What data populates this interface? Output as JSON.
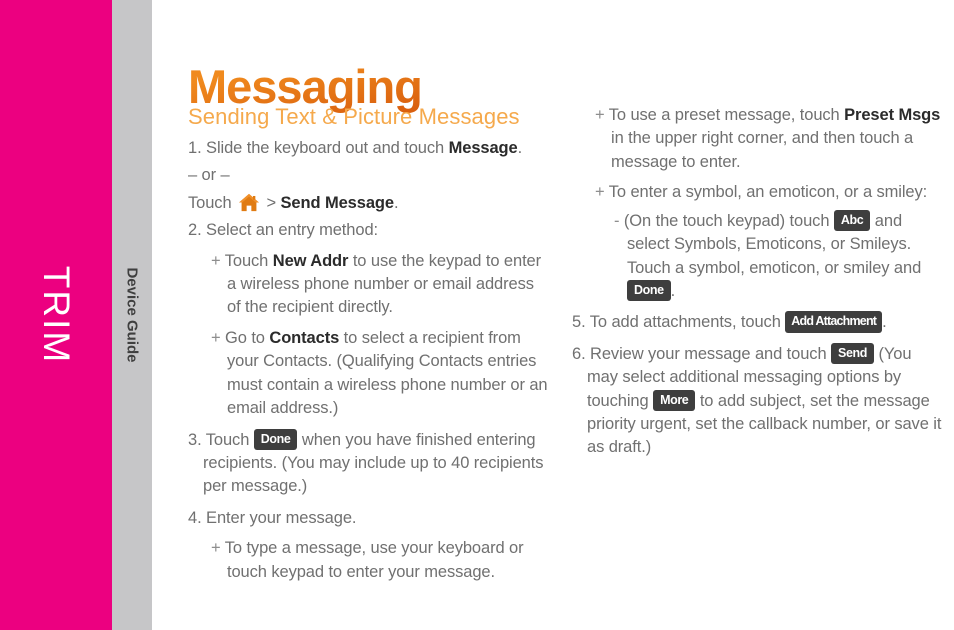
{
  "sidebar": {
    "brand": "TRIM",
    "guide_label": "Device Guide",
    "magenta_color": "#ec0080",
    "gray_color": "#c6c6c8"
  },
  "header": {
    "title": "Messaging",
    "title_color": "#e8801a"
  },
  "section": {
    "heading": "Sending Text & Picture Messages",
    "heading_color": "#f5a94c"
  },
  "keys": {
    "done": "Done",
    "abc": "Abc",
    "add_attachment": "Add Attachment",
    "send": "Send",
    "more": "More",
    "chip_bg": "#3e3e3e"
  },
  "icons": {
    "home": "home-icon"
  },
  "left_column": {
    "step1_pre": "1. Slide the keyboard out and touch ",
    "step1_bold": "Message",
    "step1_post": ".",
    "or_divider": "– or –",
    "touch_pre": "Touch ",
    "touch_sep": " > ",
    "touch_bold": "Send Message",
    "touch_post": ".",
    "step2": "2. Select an entry method:",
    "b1_mark": "+",
    "b1_pre": " Touch ",
    "b1_bold": "New Addr",
    "b1_post": " to use the keypad to enter a wireless phone number or email address of the recipient directly.",
    "b2_mark": "+",
    "b2_pre": " Go to ",
    "b2_bold": "Contacts",
    "b2_post": " to select a recipient from your Contacts. (Qualifying Contacts entries must contain a wireless phone number or an email address.)",
    "step3_pre": "3. Touch ",
    "step3_post": " when you have finished entering recipients. (You may include up to 40 recipients per message.)",
    "step4": "4. Enter your message.",
    "b3_mark": "+",
    "b3_text": " To type a message, use your keyboard or touch keypad to enter your message."
  },
  "right_column": {
    "b4_mark": "+",
    "b4_pre": " To use a preset message, touch ",
    "b4_bold": "Preset Msgs",
    "b4_post": " in the upper right corner, and then touch a message to enter.",
    "b5_mark": "+",
    "b5_text": " To enter a symbol, an emoticon, or a smiley:",
    "sb1_mark": "-",
    "sb1_pre": " (On the touch keypad) touch ",
    "sb1_mid": " and select Symbols, Emoticons, or Smileys. Touch a symbol, emoticon, or smiley and ",
    "sb1_post": ".",
    "step5_pre": "5. To add attachments, touch ",
    "step5_post": ".",
    "step6_pre": "6. Review your message and touch ",
    "step6_mid": " (You may select additional messaging options by touching ",
    "step6_post": " to add subject, set the message priority urgent, set the callback number, or save it as draft.)"
  }
}
